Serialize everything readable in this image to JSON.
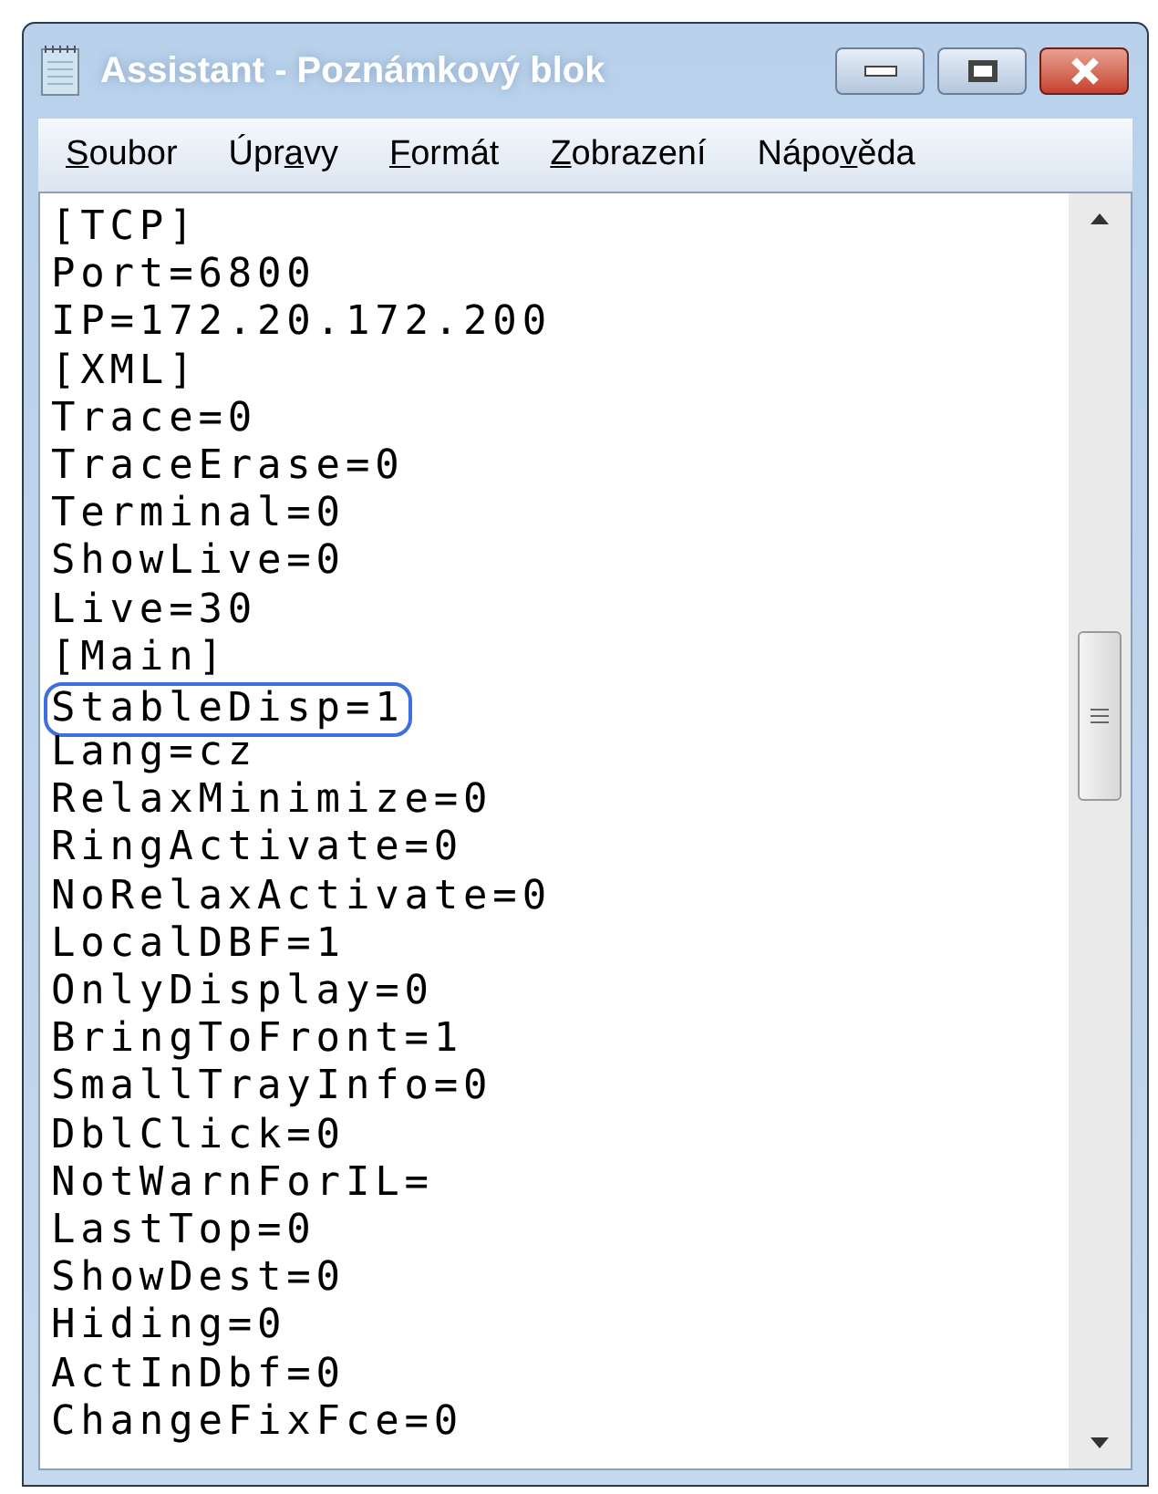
{
  "window": {
    "title": "Assistant - Poznámkový blok"
  },
  "menu": [
    {
      "key": "S",
      "after": "oubor"
    },
    {
      "before": "Úpr",
      "key": "a",
      "after": "vy"
    },
    {
      "key": "F",
      "after": "ormát"
    },
    {
      "key": "Z",
      "after": "obrazení"
    },
    {
      "before": "Nápo",
      "key": "v",
      "after": "ěda"
    }
  ],
  "lines": [
    {
      "text": "[TCP]",
      "circled": false
    },
    {
      "text": "Port=6800",
      "circled": false
    },
    {
      "text": "IP=172.20.172.200",
      "circled": false
    },
    {
      "text": "[XML]",
      "circled": false
    },
    {
      "text": "Trace=0",
      "circled": false
    },
    {
      "text": "TraceErase=0",
      "circled": false
    },
    {
      "text": "Terminal=0",
      "circled": false
    },
    {
      "text": "ShowLive=0",
      "circled": false
    },
    {
      "text": "Live=30",
      "circled": false
    },
    {
      "text": "[Main]",
      "circled": false
    },
    {
      "text": "StableDisp=1",
      "circled": true
    },
    {
      "text": "Lang=cz",
      "circled": false
    },
    {
      "text": "RelaxMinimize=0",
      "circled": false
    },
    {
      "text": "RingActivate=0",
      "circled": false
    },
    {
      "text": "NoRelaxActivate=0",
      "circled": false
    },
    {
      "text": "LocalDBF=1",
      "circled": false
    },
    {
      "text": "OnlyDisplay=0",
      "circled": false
    },
    {
      "text": "BringToFront=1",
      "circled": false
    },
    {
      "text": "SmallTrayInfo=0",
      "circled": false
    },
    {
      "text": "DblClick=0",
      "circled": false
    },
    {
      "text": "NotWarnForIL=",
      "circled": false
    },
    {
      "text": "LastTop=0",
      "circled": false
    },
    {
      "text": "ShowDest=0",
      "circled": false
    },
    {
      "text": "Hiding=0",
      "circled": false
    },
    {
      "text": "ActInDbf=0",
      "circled": false
    },
    {
      "text": "ChangeFixFce=0",
      "circled": false
    }
  ]
}
